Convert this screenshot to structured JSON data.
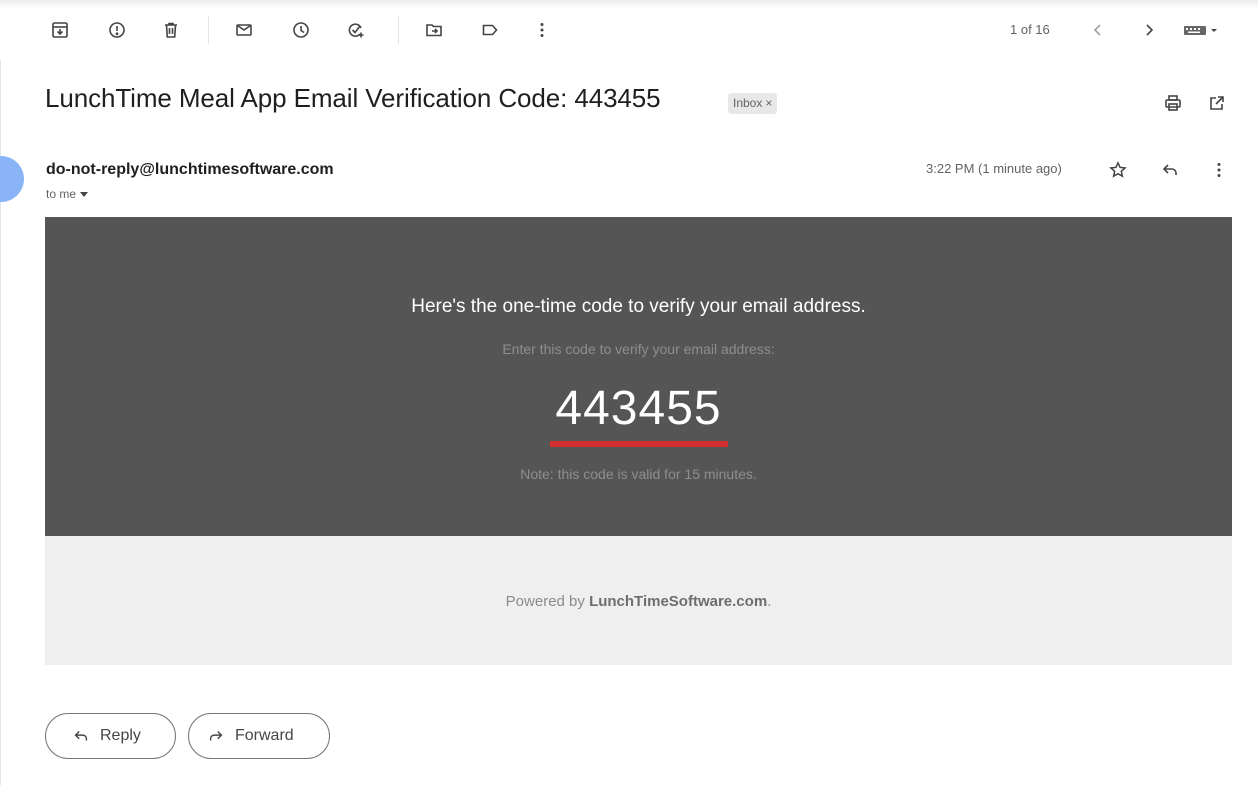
{
  "toolbar": {
    "pager_text": "1 of 16",
    "icons": [
      "archive-icon",
      "report-spam-icon",
      "delete-icon",
      "mark-unread-icon",
      "snooze-icon",
      "add-to-tasks-icon",
      "move-to-icon",
      "label-icon",
      "more-vert-icon",
      "prev-icon",
      "next-icon",
      "keyboard-icon"
    ]
  },
  "email": {
    "subject": "LunchTime Meal App Email Verification Code: 443455",
    "label": "Inbox",
    "label_close": "×",
    "sender": "do-not-reply@lunchtimesoftware.com",
    "to": "to me",
    "time": "3:22 PM (1 minute ago)"
  },
  "body": {
    "headline": "Here's the one-time code to verify your email address.",
    "instruction": "Enter this code to verify your email address:",
    "code": "443455",
    "note": "Note: this code is valid for 15 minutes.",
    "powered_prefix": "Powered by ",
    "powered_brand": "LunchTimeSoftware.com",
    "powered_suffix": "."
  },
  "actions": {
    "reply_label": "Reply",
    "forward_label": "Forward"
  },
  "colors": {
    "accent_underline": "#d32f2f",
    "mail_dark_bg": "#555555",
    "mail_light_bg": "#efefef"
  }
}
